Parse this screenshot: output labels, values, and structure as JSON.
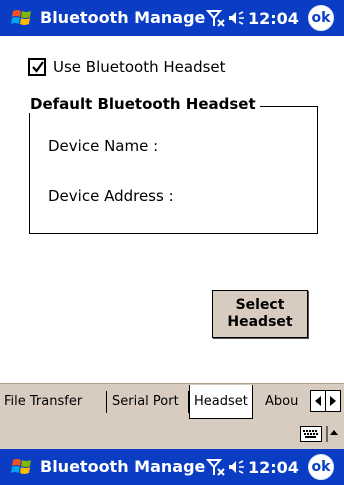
{
  "titlebar": {
    "title": "Bluetooth Manage",
    "time": "12:04",
    "ok_label": "ok"
  },
  "icons": {
    "start": "windows-flag-icon",
    "signal": "signal-off-icon",
    "speaker": "speaker-icon",
    "keyboard": "keyboard-icon"
  },
  "headset": {
    "use_checkbox_label": "Use Bluetooth Headset",
    "use_checked": true,
    "group_title": "Default Bluetooth Headset",
    "device_name_label": "Device Name     :",
    "device_address_label": "Device Address :",
    "select_button": [
      "Select",
      "Headset"
    ]
  },
  "tabs": {
    "items": [
      "File Transfer",
      "Serial Port",
      "Headset",
      "Abou"
    ],
    "active": "Headset"
  },
  "colors": {
    "titlebar": "#0a3dc4",
    "chrome": "#d8ccc0"
  }
}
